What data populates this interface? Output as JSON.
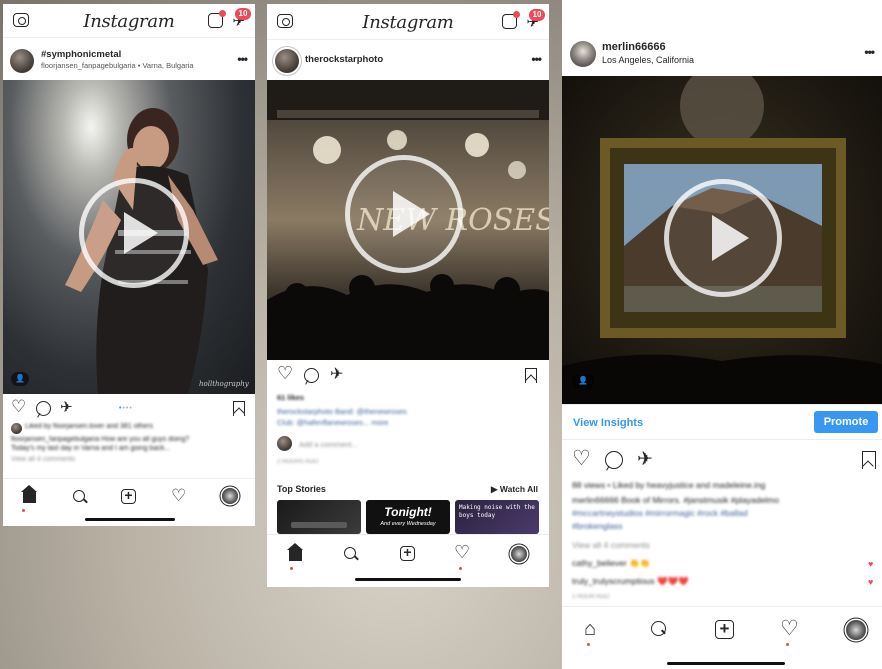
{
  "phone1": {
    "logo": "Instagram",
    "notification_count": "10",
    "username": "#symphonicmetal",
    "location": "floorjansen_fanpagebulgaria • Varna, Bulgaria",
    "watermark": "hollthography",
    "liked_by": "Liked by floorjansen.lover and 381 others",
    "caption": "floorjansen_fanpagebulgaria How are you all guys doing?",
    "caption2": "Today's my last day in Varna and I am going back...",
    "view_comments": "View all 4 comments"
  },
  "phone2": {
    "logo": "Instagram",
    "notification_count": "10",
    "username": "therockstarphoto",
    "likes": "61 likes",
    "caption": "therockstarphoto Band: @thenewroses",
    "caption2": "Club: @hafenflanewroses... more",
    "add_comment": "Add a comment...",
    "time": "2 HOURS AGO",
    "top_stories_label": "Top Stories",
    "watch_all_label": "▶ Watch All",
    "story2_text": "Tonight!",
    "story2_sub": "And every Wednesday",
    "story3_text": "Making noise with the boys today"
  },
  "phone3": {
    "username": "merlin66666",
    "location": "Los Angeles, California",
    "view_insights": "View Insights",
    "promote": "Promote",
    "views": "88 views • Liked by heavyjustice and madeleine.ing",
    "caption1": "merlin66666 Book of Mirrors. #janstmusik #playadelmo",
    "caption2": "#mccartneystudios #mirrormagic #rock #ballad",
    "caption3": "#brokenglass",
    "view_comments": "View all 4 comments",
    "comment1": "cathy_believer 👏👏",
    "comment2": "truly_trulyscrumptious ❤️❤️❤️",
    "time": "1 HOUR AGO"
  },
  "icons": {
    "heart": "♡",
    "send": "✈",
    "more": "•••",
    "user_tag": "👤",
    "heart_filled": "♥"
  },
  "colors": {
    "accent_blue": "#3897f0",
    "notify_red": "#ed4956"
  }
}
